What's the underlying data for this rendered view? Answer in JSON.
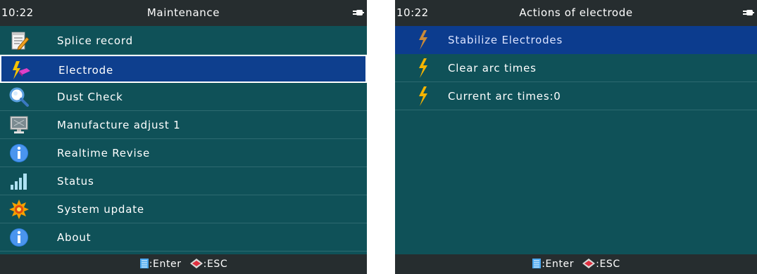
{
  "left_screen": {
    "time": "10:22",
    "title": "Maintenance",
    "items": [
      {
        "label": "Splice record",
        "icon": "notepad-pencil-icon"
      },
      {
        "label": "Electrode",
        "icon": "lightning-eraser-icon",
        "selected": true
      },
      {
        "label": "Dust Check",
        "icon": "magnifier-icon"
      },
      {
        "label": "Manufacture adjust 1",
        "icon": "monitor-icon"
      },
      {
        "label": "Realtime Revise",
        "icon": "info-icon"
      },
      {
        "label": "Status",
        "icon": "signal-bars-icon"
      },
      {
        "label": "System update",
        "icon": "gear-burst-icon"
      },
      {
        "label": "About",
        "icon": "info-icon"
      }
    ],
    "footer": {
      "enter_label": ":Enter",
      "esc_label": ":ESC"
    }
  },
  "right_screen": {
    "time": "10:22",
    "title": "Actions of electrode",
    "items": [
      {
        "label": "Stabilize Electrodes",
        "icon": "lightning-icon",
        "selected": true
      },
      {
        "label": "Clear arc times",
        "icon": "lightning-icon"
      },
      {
        "label": "Current arc times:0",
        "icon": "lightning-icon"
      }
    ],
    "footer": {
      "enter_label": ":Enter",
      "esc_label": ":ESC"
    }
  },
  "colors": {
    "background": "#0f5158",
    "bar": "#262d2f",
    "selection": "#0e3f8e",
    "bolt": "#f5b400"
  }
}
